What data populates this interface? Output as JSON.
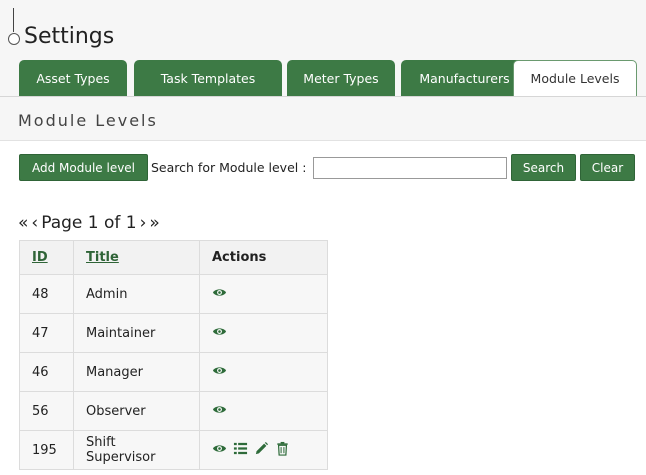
{
  "page": {
    "title": "Settings"
  },
  "tabs": [
    {
      "label": "Asset Types",
      "active": false
    },
    {
      "label": "Task Templates",
      "active": false
    },
    {
      "label": "Meter Types",
      "active": false
    },
    {
      "label": "Manufacturers",
      "active": false
    },
    {
      "label": "Module Levels",
      "active": true
    }
  ],
  "section": {
    "title": "Module Levels"
  },
  "toolbar": {
    "add_label": "Add Module level",
    "search_label": "Search for Module level :",
    "search_value": "",
    "search_button": "Search",
    "clear_button": "Clear"
  },
  "pager": {
    "first": "«",
    "prev": "‹",
    "text": "Page 1 of 1",
    "next": "›",
    "last": "»"
  },
  "table": {
    "headers": {
      "id": "ID",
      "title": "Title",
      "actions": "Actions"
    },
    "rows": [
      {
        "id": "48",
        "title": "Admin",
        "actions": [
          "view-icon"
        ]
      },
      {
        "id": "47",
        "title": "Maintainer",
        "actions": [
          "view-icon"
        ]
      },
      {
        "id": "46",
        "title": "Manager",
        "actions": [
          "view-icon"
        ]
      },
      {
        "id": "56",
        "title": "Observer",
        "actions": [
          "view-icon"
        ]
      },
      {
        "id": "195",
        "title": "Shift Supervisor",
        "actions": [
          "view-icon",
          "list-icon",
          "edit-icon",
          "delete-icon"
        ]
      }
    ]
  },
  "colors": {
    "accent": "#3d7a45",
    "accent_dark": "#2f6437",
    "icon": "#2e6b3a"
  }
}
